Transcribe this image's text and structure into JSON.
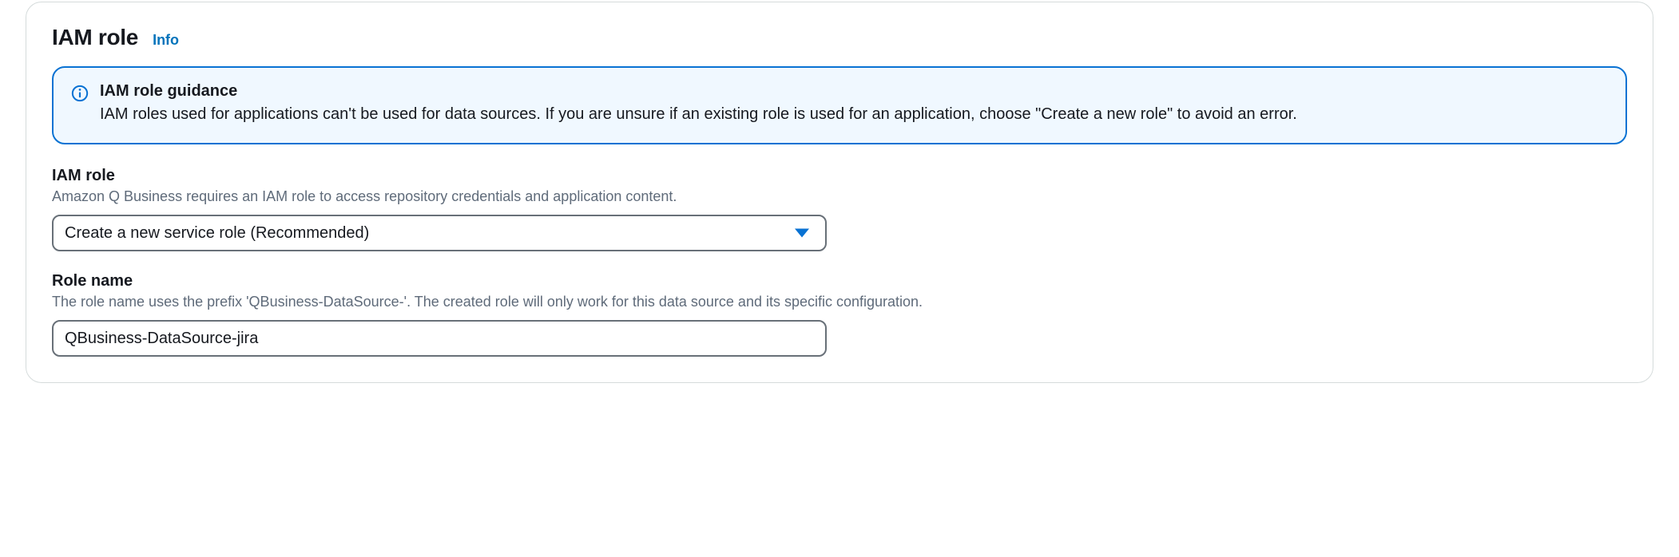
{
  "panel": {
    "title": "IAM role",
    "info_link": "Info"
  },
  "alert": {
    "title": "IAM role guidance",
    "body": "IAM roles used for applications can't be used for data sources. If you are unsure if an existing role is used for an application, choose \"Create a new role\" to avoid an error."
  },
  "iam_role_field": {
    "label": "IAM role",
    "hint": "Amazon Q Business requires an IAM role to access repository credentials and application content.",
    "selected": "Create a new service role (Recommended)"
  },
  "role_name_field": {
    "label": "Role name",
    "hint": "The role name uses the prefix 'QBusiness-DataSource-'. The created role will only work for this data source and its specific configuration.",
    "value": "QBusiness-DataSource-jira"
  }
}
